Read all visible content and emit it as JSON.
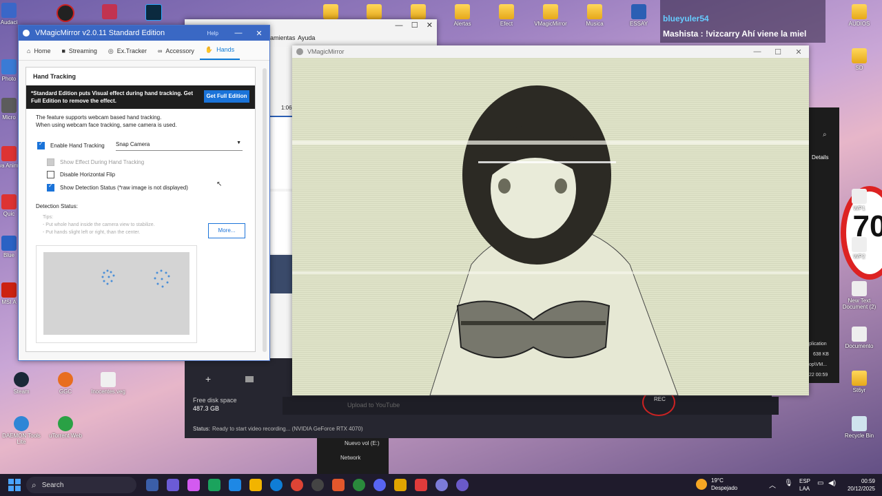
{
  "desktop": {
    "left_icons": [
      {
        "label": "Audaci",
        "color": "#3a67c8"
      },
      {
        "label": "Photo",
        "color": "#3a7bd5"
      },
      {
        "label": "Micro",
        "color": "#5c5c5c"
      },
      {
        "label": "Ava Animat",
        "color": "#d33"
      },
      {
        "label": "Quic",
        "color": "#d33"
      },
      {
        "label": "Blue",
        "color": "#2a62c4"
      },
      {
        "label": "MSI A",
        "color": "#c21"
      }
    ],
    "top_icons": [
      {
        "label": "Alertas"
      },
      {
        "label": "Efect"
      },
      {
        "label": "VMagicMirror"
      },
      {
        "label": "Musica"
      },
      {
        "label": "ESSAY"
      },
      {
        "label": "AUDIOS"
      }
    ],
    "right_icons": [
      {
        "label": "SD"
      },
      {
        "label": "WP1"
      },
      {
        "label": "WP2"
      },
      {
        "label": "New Text Document (2)"
      },
      {
        "label": "Documento"
      },
      {
        "label": "St6yr"
      },
      {
        "label": "Recycle Bin"
      }
    ],
    "bottom_icons": [
      {
        "label": "Steam"
      },
      {
        "label": "GGC"
      },
      {
        "label": "Inocentes.veg"
      },
      {
        "label": "DAEMON Tools Lite"
      },
      {
        "label": "uTorrent Web"
      }
    ],
    "speed_sign": "70",
    "chat_name": "blueyuler54",
    "chat_line": "Mashista : !vizcarry Ahí viene la miel"
  },
  "bg_app": {
    "menu_items": [
      "amientas",
      "Ayuda"
    ],
    "time_mark": "1:06",
    "disk_label": "Free disk space",
    "disk_value": "487.3 GB",
    "upload_label": "Upload to YouTube",
    "rec_label": "REC",
    "status_label": "Status:",
    "status_text": "Ready to start video recording... (NVIDIA GeForce RTX 4070)",
    "tree_items": [
      "Nuevo vol (E:)",
      "Network"
    ],
    "details_label": "Details",
    "file_info": [
      "plication",
      "638 KB",
      "op\\VM...",
      "22 00:59"
    ]
  },
  "vmm_settings": {
    "title": "VMagicMirror v2.0.11 Standard Edition",
    "help": "Help",
    "tabs": [
      "Home",
      "Streaming",
      "Ex.Tracker",
      "Accessory",
      "Hands"
    ],
    "section_title": "Hand Tracking",
    "banner_text": "*Standard Edition puts Visual effect during hand tracking. Get Full Edition to remove the effect.",
    "banner_button": "Get Full Edition",
    "desc1": "The feature supports webcam based hand tracking.",
    "desc2": "When using webcam face tracking, same camera is used.",
    "enable_label": "Enable Hand Tracking",
    "camera_value": "Snap Camera",
    "show_effect": "Show Effect During Hand Tracking",
    "disable_flip": "Disable Horizontal Flip",
    "show_status": "Show Detection Status (*raw image is not displayed)",
    "detection_label": "Detection Status:",
    "tips_title": "Tips:",
    "tip1": "- Put whole hand inside the camera view to stabilize.",
    "tip2": "- Put hands slight left or right, than the center.",
    "more_button": "More..."
  },
  "vmm_main": {
    "title": "VMagicMirror"
  },
  "taskbar": {
    "search_placeholder": "Search",
    "weather_temp": "19°C",
    "weather_desc": "Despejado",
    "lang1": "ESP",
    "lang2": "LAA",
    "time": "00:59",
    "date": "20/12/2025",
    "app_icon_colors": [
      "#3b5ea8",
      "#6b5bd6",
      "#d35af0",
      "#1ba35d",
      "#1e88e5",
      "#f2b400",
      "#0f7dd6",
      "#dd4435",
      "#444",
      "#e2572c",
      "#2a8a3c",
      "#5865f2",
      "#e0a400",
      "#e03b3b",
      "#7b7bd8",
      "#6a5ac8"
    ]
  }
}
